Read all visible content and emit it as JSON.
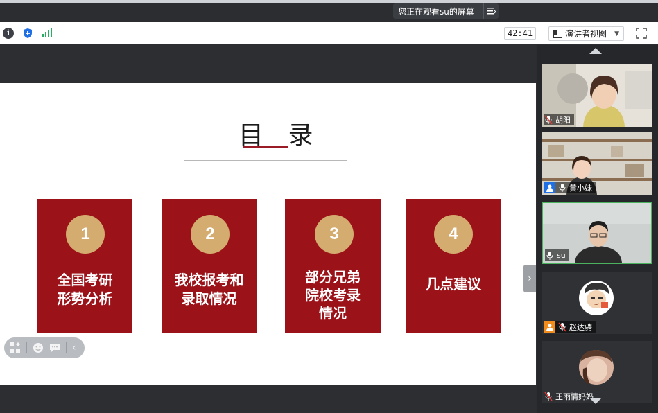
{
  "banner": {
    "text": "您正在观看su的屏幕",
    "menu_icon": "list-menu-icon"
  },
  "toolbar": {
    "timer": "42:41",
    "view_label": "演讲者视图",
    "icons": [
      "info-icon",
      "shield-icon",
      "signal-icon",
      "fullscreen-icon"
    ]
  },
  "slide": {
    "title": "目 录",
    "accent_color": "#9b1219",
    "circle_color": "#d4ac70",
    "cards": [
      {
        "number": "1",
        "line1": "全国考研",
        "line2": "形势分析",
        "line3": ""
      },
      {
        "number": "2",
        "line1": "我校报考和",
        "line2": "录取情况",
        "line3": ""
      },
      {
        "number": "3",
        "line1": "部分兄弟",
        "line2": "院校考录",
        "line3": "情况"
      },
      {
        "number": "4",
        "line1": "几点建议",
        "line2": "",
        "line3": ""
      }
    ]
  },
  "participants": [
    {
      "name": "胡阳",
      "mic": "muted",
      "active": false
    },
    {
      "name": "黄小妹",
      "mic": "on",
      "host": true,
      "active": false
    },
    {
      "name": "su",
      "mic": "on",
      "active": true
    },
    {
      "name": "赵达骋",
      "mic": "muted",
      "host": true,
      "active": false
    },
    {
      "name": "王雨情妈妈",
      "mic": "muted",
      "active": false
    }
  ]
}
